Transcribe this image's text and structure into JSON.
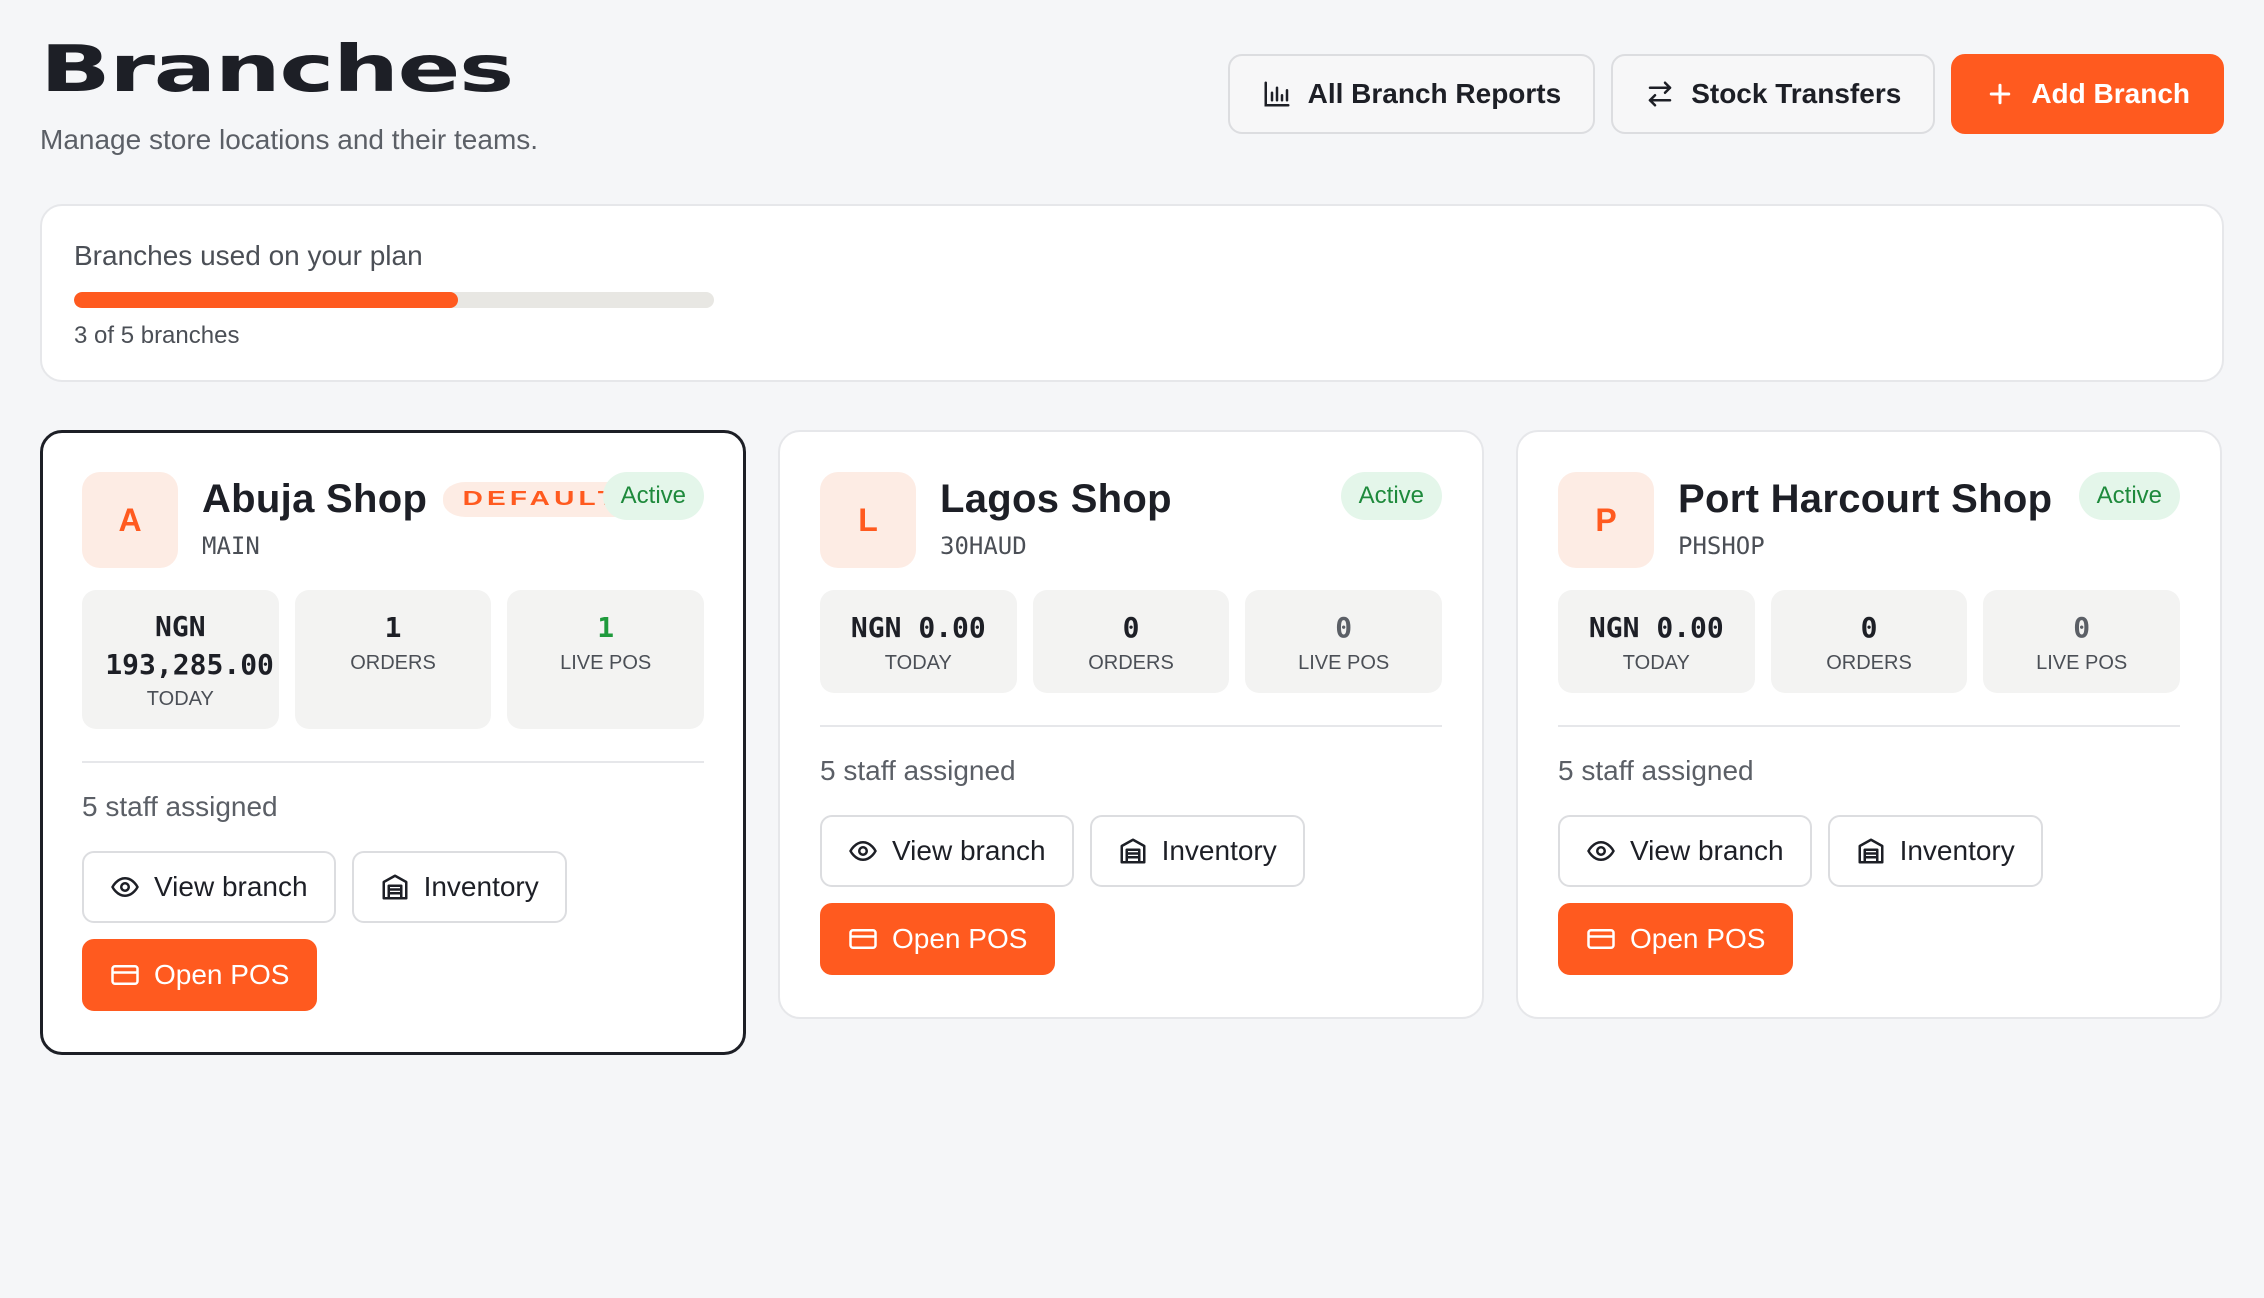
{
  "header": {
    "title": "Branches",
    "subtitle": "Manage store locations and their teams.",
    "reports_label": "All Branch Reports",
    "transfers_label": "Stock Transfers",
    "add_label": "Add Branch"
  },
  "plan": {
    "label": "Branches used on your plan",
    "used": 3,
    "limit": 5,
    "count_text": "3 of 5 branches",
    "progress_fraction": 0.6
  },
  "colors": {
    "accent": "#ff5a1f",
    "active_green": "#1e8a3c",
    "avatar_bg": "#fdece4"
  },
  "branches": [
    {
      "initial": "A",
      "name": "Abuja Shop",
      "badge": "DEFAULT",
      "code": "MAIN",
      "status": "Active",
      "revenue": "NGN 193,285.00",
      "revenue_label": "TODAY",
      "orders": "1",
      "orders_label": "ORDERS",
      "live_pos": "1",
      "live_pos_label": "LIVE POS",
      "staff": "5 staff assigned",
      "view_label": "View branch",
      "inventory_label": "Inventory",
      "pos_label": "Open POS"
    },
    {
      "initial": "L",
      "name": "Lagos Shop",
      "code": "30HAUD",
      "status": "Active",
      "revenue": "NGN 0.00",
      "revenue_label": "TODAY",
      "orders": "0",
      "orders_label": "ORDERS",
      "live_pos": "0",
      "live_pos_label": "LIVE POS",
      "staff": "5 staff assigned",
      "view_label": "View branch",
      "inventory_label": "Inventory",
      "pos_label": "Open POS"
    },
    {
      "initial": "P",
      "name": "Port Harcourt Shop",
      "code": "PHSHOP",
      "status": "Active",
      "revenue": "NGN 0.00",
      "revenue_label": "TODAY",
      "orders": "0",
      "orders_label": "ORDERS",
      "live_pos": "0",
      "live_pos_label": "LIVE POS",
      "staff": "5 staff assigned",
      "view_label": "View branch",
      "inventory_label": "Inventory",
      "pos_label": "Open POS"
    }
  ]
}
